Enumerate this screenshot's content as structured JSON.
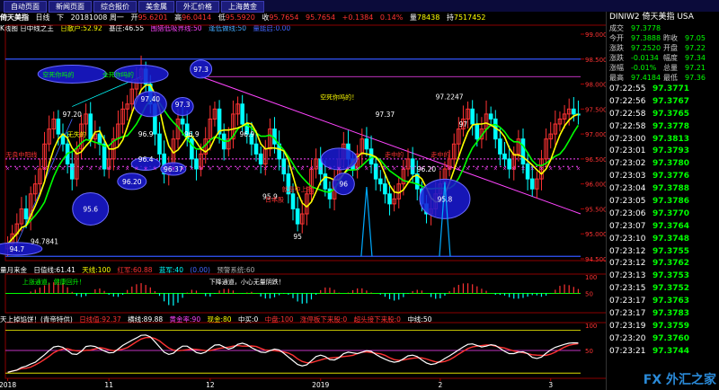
{
  "menu": [
    "自动页面",
    "新闻页面",
    "综合报价",
    "美金属",
    "外汇价格",
    "上海黄金"
  ],
  "header": {
    "name": "倚天美指",
    "period": "日线",
    "label_down": "下",
    "date": "20181008 周一",
    "open_label": "开",
    "open": "95.6201",
    "high_label": "高",
    "high": "96.0414",
    "low_label": "低",
    "low": "95.5920",
    "close_label": "收",
    "close": "95.7654",
    "last": "95.7654",
    "change": "+0.1384",
    "change_pct": "0.14%",
    "vol_label": "量",
    "vol": "78438",
    "oi_label": "持",
    "oi": "7517452"
  },
  "indicator_main": {
    "name": "K线图 日中线之王",
    "items": [
      {
        "text": "日散户:52.92",
        "color": "#ffff00"
      },
      {
        "text": "基庄:46.55",
        "color": "#ffffff"
      },
      {
        "text": "围猎低吸界线:50",
        "color": "#ff44ff"
      },
      {
        "text": "逢低做线:50",
        "color": "#44aaff"
      },
      {
        "text": "量能启:0.00",
        "color": "#4466ff"
      }
    ]
  },
  "indicator_panel2": {
    "items": [
      {
        "text": "量月来金",
        "color": "#ffffff"
      },
      {
        "text": "日值线:61.41",
        "color": "#ffffff"
      },
      {
        "text": "天线:100",
        "color": "#ffff00"
      },
      {
        "text": "红军:60.88",
        "color": "#ff3333"
      },
      {
        "text": "蓝军:40",
        "color": "#00ffff"
      },
      {
        "text": "(0.00)",
        "color": "#4466ff"
      },
      {
        "text": "预警系统:60",
        "color": "#aaaaaa"
      }
    ]
  },
  "indicator_panel3": {
    "items": [
      {
        "text": "天上掉馅饼！(青帝特供)",
        "color": "#ffffff"
      },
      {
        "text": "日线值:92.37",
        "color": "#ff3333"
      },
      {
        "text": "横线:89.88",
        "color": "#ffffff"
      },
      {
        "text": "黄金率:90",
        "color": "#ff44ff"
      },
      {
        "text": "现金:80",
        "color": "#ffff00"
      },
      {
        "text": "中买:0",
        "color": "#ffffff"
      },
      {
        "text": "中盘:100",
        "color": "#ff3333"
      },
      {
        "text": "涨停板下来股:0",
        "color": "#ff3333"
      },
      {
        "text": "超头接下来股:0",
        "color": "#ff3333"
      },
      {
        "text": "中线:50",
        "color": "#ffffff"
      }
    ]
  },
  "quote": {
    "title": "DINIW2  倚天美指   USA",
    "rows": [
      {
        "k": "成交",
        "v": "97.3778",
        "k2": "",
        "v2": ""
      },
      {
        "k": "今开",
        "v": "97.3888",
        "k2": "昨收",
        "v2": "97.05"
      },
      {
        "k": "涨跌",
        "v": "97.2520",
        "k2": "开盘",
        "v2": "97.22"
      },
      {
        "k": "涨跌",
        "v": "-0.0134",
        "k2": "幅度",
        "v2": "97.34"
      },
      {
        "k": "涨幅",
        "v": "-0.01%",
        "k2": "总量",
        "v2": "97.21"
      },
      {
        "k": "最高",
        "v": "97.4184",
        "k2": "最低",
        "v2": "97.36"
      }
    ],
    "ticks": [
      {
        "t": "07:22:55",
        "p": "97.3771"
      },
      {
        "t": "07:22:56",
        "p": "97.3767"
      },
      {
        "t": "07:22:58",
        "p": "97.3765"
      },
      {
        "t": "07:22:58",
        "p": "97.3778"
      },
      {
        "t": "07:23:00",
        "p": "97.3813"
      },
      {
        "t": "07:23:01",
        "p": "97.3793"
      },
      {
        "t": "07:23:02",
        "p": "97.3780"
      },
      {
        "t": "07:23:03",
        "p": "97.3776"
      },
      {
        "t": "07:23:04",
        "p": "97.3788"
      },
      {
        "t": "07:23:05",
        "p": "97.3786"
      },
      {
        "t": "07:23:06",
        "p": "97.3770"
      },
      {
        "t": "07:23:07",
        "p": "97.3764"
      },
      {
        "t": "07:23:10",
        "p": "97.3748"
      },
      {
        "t": "07:23:12",
        "p": "97.3755"
      },
      {
        "t": "07:23:12",
        "p": "97.3762"
      },
      {
        "t": "07:23:13",
        "p": "97.3753"
      },
      {
        "t": "07:23:15",
        "p": "97.3752"
      },
      {
        "t": "07:23:17",
        "p": "97.3763"
      },
      {
        "t": "07:23:17",
        "p": "97.3783"
      },
      {
        "t": "07:23:19",
        "p": "97.3759"
      },
      {
        "t": "07:23:20",
        "p": "97.3760"
      },
      {
        "t": "07:23:21",
        "p": "97.3744"
      }
    ]
  },
  "logo": "FX 外汇之家",
  "chart_data": [
    {
      "type": "line",
      "title": "K线图 日中线之王",
      "ylim": [
        94.5,
        99.0
      ],
      "yticks": [
        "99.0000",
        "98.5000",
        "98.0000",
        "97.5000",
        "97.0000",
        "96.5000",
        "96.0000",
        "95.5000",
        "95.0000",
        "94.5000"
      ],
      "ytick_values": [
        99.0,
        98.5,
        98.0,
        97.5,
        97.0,
        96.5,
        96.0,
        95.5,
        95.0,
        94.5
      ],
      "x_labels": [
        "2018",
        "11",
        "12",
        "2019",
        "2",
        "3"
      ],
      "x_label_index": [
        0,
        22,
        44,
        68,
        94,
        118
      ],
      "closes": [
        94.8,
        95.0,
        95.2,
        95.5,
        95.3,
        95.8,
        96.0,
        96.3,
        96.8,
        97.1,
        97.3,
        97.0,
        96.8,
        96.4,
        96.1,
        96.7,
        97.2,
        97.4,
        96.9,
        97.0,
        96.8,
        96.3,
        96.5,
        96.9,
        97.2,
        97.5,
        97.6,
        97.9,
        98.1,
        98.3,
        98.0,
        97.6,
        97.0,
        96.6,
        96.2,
        96.4,
        96.9,
        97.3,
        97.2,
        96.9,
        96.5,
        96.3,
        96.6,
        96.9,
        97.3,
        97.5,
        97.0,
        96.7,
        96.9,
        97.4,
        97.6,
        97.2,
        97.0,
        96.8,
        96.6,
        96.4,
        96.7,
        97.1,
        96.8,
        96.5,
        96.2,
        95.8,
        95.5,
        95.2,
        95.4,
        95.8,
        96.3,
        96.5,
        96.2,
        95.9,
        95.7,
        96.1,
        96.5,
        96.8,
        96.5,
        96.3,
        96.6,
        96.9,
        96.7,
        96.4,
        96.1,
        96.0,
        95.8,
        95.6,
        95.7,
        96.0,
        96.3,
        96.5,
        96.2,
        95.9,
        95.6,
        95.4,
        95.5,
        95.8,
        96.0,
        96.3,
        96.5,
        96.8,
        97.1,
        97.3,
        97.5,
        97.2,
        96.9,
        97.1,
        97.4,
        97.3,
        96.9,
        96.6,
        96.5,
        96.3,
        96.6,
        96.9,
        96.4,
        96.1,
        95.9,
        96.1,
        96.5,
        96.9,
        97.0,
        97.2,
        97.3,
        97.4,
        97.5,
        97.4,
        97.38
      ],
      "annotations": [
        {
          "text": "94.7",
          "i": 2,
          "v": 94.7
        },
        {
          "text": "94.7841",
          "i": 8,
          "v": 94.85
        },
        {
          "text": "97.20",
          "i": 14,
          "v": 97.4
        },
        {
          "text": "95.6",
          "i": 18,
          "v": 95.5
        },
        {
          "text": "97.40",
          "i": 31,
          "v": 97.7
        },
        {
          "text": "96.9",
          "i": 30,
          "v": 97.0
        },
        {
          "text": "96.4",
          "i": 30,
          "v": 96.5
        },
        {
          "text": "96.20",
          "i": 27,
          "v": 96.05
        },
        {
          "text": "96.37",
          "i": 36,
          "v": 96.3
        },
        {
          "text": "97.3",
          "i": 42,
          "v": 98.3
        },
        {
          "text": "97.3",
          "i": 38,
          "v": 97.6
        },
        {
          "text": "96.9",
          "i": 40,
          "v": 97.0
        },
        {
          "text": "96.9",
          "i": 52,
          "v": 97.0
        },
        {
          "text": "95.9",
          "i": 57,
          "v": 95.75
        },
        {
          "text": "95",
          "i": 63,
          "v": 94.95
        },
        {
          "text": "96",
          "i": 73,
          "v": 96.0
        },
        {
          "text": "97.37",
          "i": 82,
          "v": 97.4
        },
        {
          "text": "96.20",
          "i": 91,
          "v": 96.3
        },
        {
          "text": "95.8",
          "i": 95,
          "v": 95.7
        },
        {
          "text": "97.2247",
          "i": 96,
          "v": 97.75
        },
        {
          "text": "97",
          "i": 99,
          "v": 97.2
        }
      ],
      "notes": [
        {
          "text": "空死你吗的！",
          "color": "#ffff00",
          "i": 72,
          "v": 97.75
        },
        {
          "text": "空死你吗的",
          "color": "#00ff00",
          "i": 11,
          "v": 98.2
        },
        {
          "text": "全死你吗的",
          "color": "#00ff00",
          "i": 24,
          "v": 98.2
        },
        {
          "text": "无失的",
          "color": "#ffff00",
          "i": 15,
          "v": 97.0
        },
        {
          "text": "无良中阳线",
          "color": "#ff3333",
          "i": 3,
          "v": 96.6
        },
        {
          "text": "就是中上扬",
          "color": "#ff3333",
          "i": 63,
          "v": 95.9
        },
        {
          "text": "日本股",
          "color": "#ff3333",
          "i": 58,
          "v": 95.7
        },
        {
          "text": "走中的",
          "color": "#ff3333",
          "i": 84,
          "v": 96.6
        },
        {
          "text": "走中的",
          "color": "#ff3333",
          "i": 94,
          "v": 96.6
        }
      ]
    },
    {
      "type": "area",
      "title": "量月来金",
      "ylim": [
        0,
        100
      ],
      "yticks": [
        "100",
        "50"
      ],
      "ytick_values": [
        100,
        50
      ],
      "notes": [
        {
          "text": "下降通道，小心无量阴跌！",
          "color": "#ffffff",
          "i": 52
        },
        {
          "text": "上涨通道，健康回升！",
          "color": "#00ff00",
          "i": 10
        }
      ]
    },
    {
      "type": "line",
      "title": "天上掉馅饼！",
      "ylim": [
        0,
        100
      ],
      "yticks": [
        "100",
        "50"
      ],
      "ytick_values": [
        100,
        50
      ]
    }
  ]
}
